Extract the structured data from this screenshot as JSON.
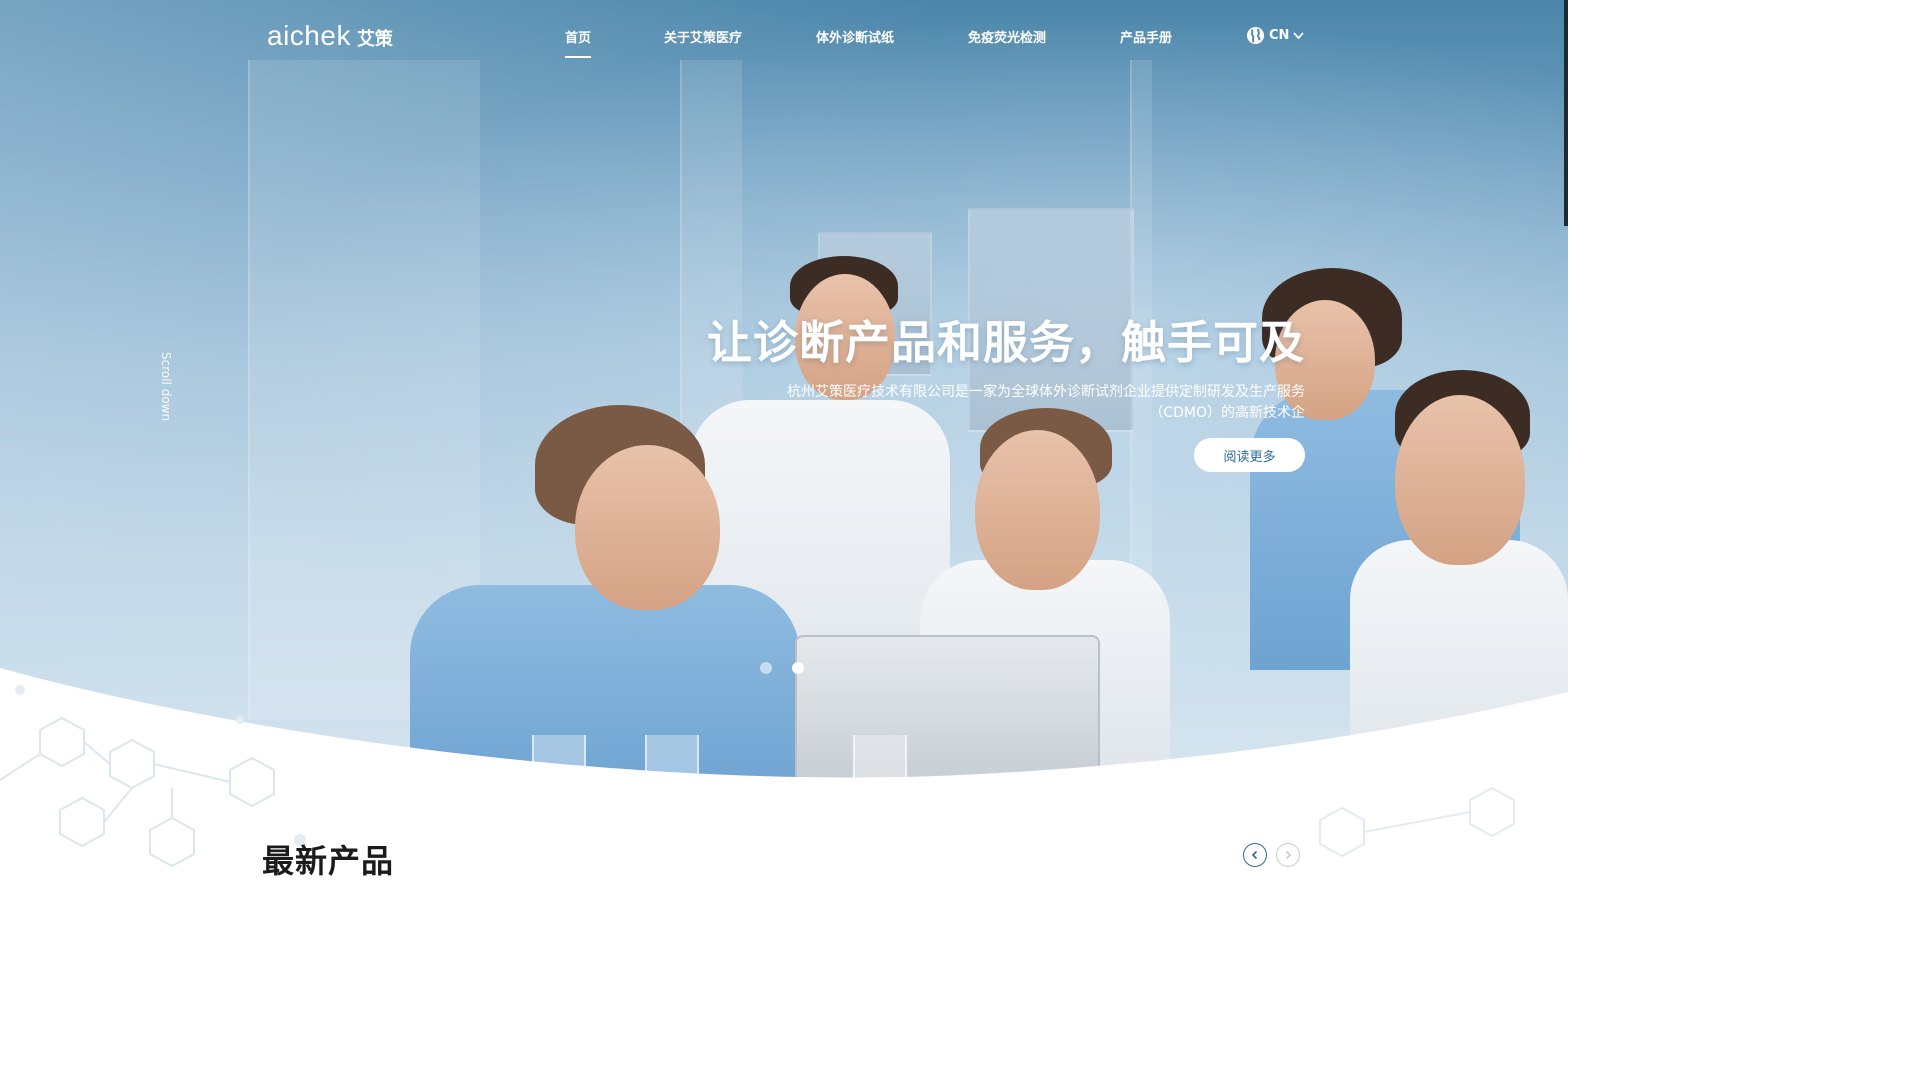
{
  "brand": {
    "logo_text": "aichek",
    "logo_cn": "艾策"
  },
  "nav": {
    "items": [
      {
        "label": "首页",
        "active": true
      },
      {
        "label": "关于艾策医疗",
        "active": false
      },
      {
        "label": "体外诊断试纸",
        "active": false
      },
      {
        "label": "免疫荧光检测",
        "active": false
      },
      {
        "label": "产品手册",
        "active": false
      }
    ],
    "language": {
      "label": "CN",
      "icon": "globe-icon"
    }
  },
  "hero": {
    "headline": "让诊断产品和服务，触手可及",
    "subline": "杭州艾策医疗技术有限公司是一家为全球体外诊断试剂企业提供定制研发及生产服务（CDMO）的高新技术企",
    "cta_label": "阅读更多",
    "scroll_hint": "Scroll down",
    "carousel": {
      "slides": 2,
      "active_slide": 2
    }
  },
  "products_section": {
    "title": "最新产品",
    "prev_icon": "chevron-left-icon",
    "next_icon": "chevron-right-icon"
  },
  "colors": {
    "accent": "#2d6c98",
    "hero_top": "#4b86aa",
    "text_dark": "#1b1b1b"
  }
}
